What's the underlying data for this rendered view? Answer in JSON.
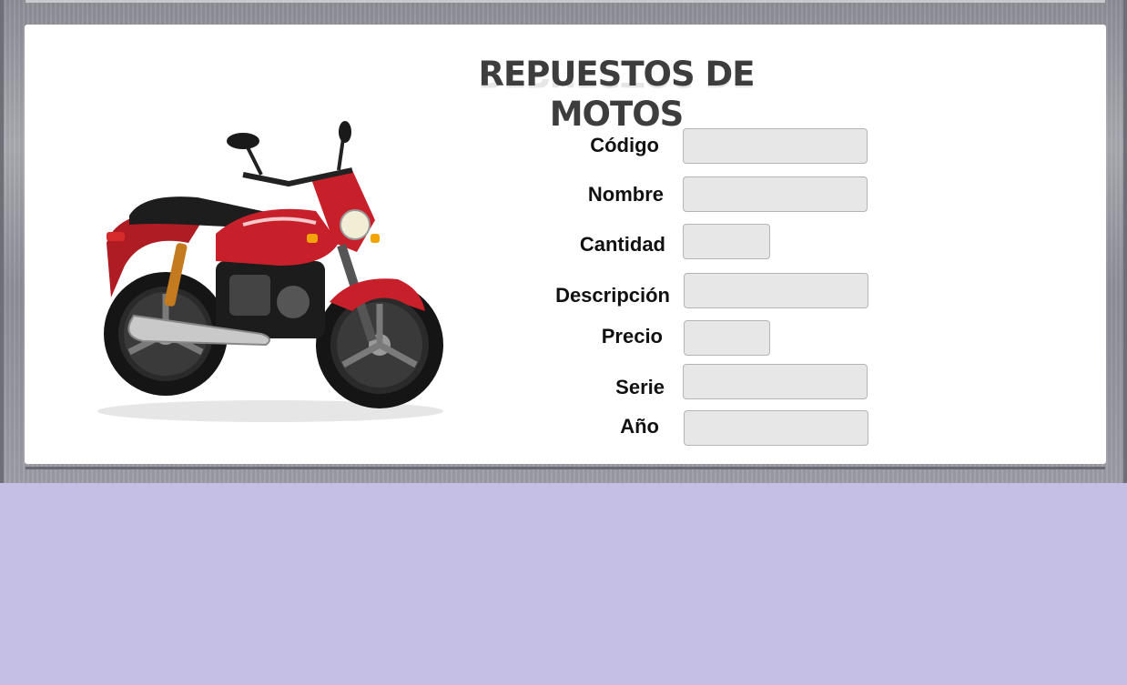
{
  "title": "REPUESTOS DE MOTOS",
  "image": {
    "icon": "motorcycle-image",
    "alt": ""
  },
  "form": {
    "fields": [
      {
        "key": "codigo",
        "label": "Código",
        "value": ""
      },
      {
        "key": "nombre",
        "label": "Nombre",
        "value": ""
      },
      {
        "key": "cantidad",
        "label": "Cantidad",
        "value": ""
      },
      {
        "key": "descripcion",
        "label": "Descripción",
        "value": ""
      },
      {
        "key": "precio",
        "label": "Precio",
        "value": ""
      },
      {
        "key": "serie",
        "label": "Serie",
        "value": ""
      },
      {
        "key": "anio",
        "label": "Año",
        "value": ""
      }
    ]
  },
  "colors": {
    "background": "#c6bfe5",
    "frame": "#9a9aa3",
    "panel": "#ffffff",
    "input_bg": "#e7e7e7",
    "bike_red": "#c8202a"
  }
}
